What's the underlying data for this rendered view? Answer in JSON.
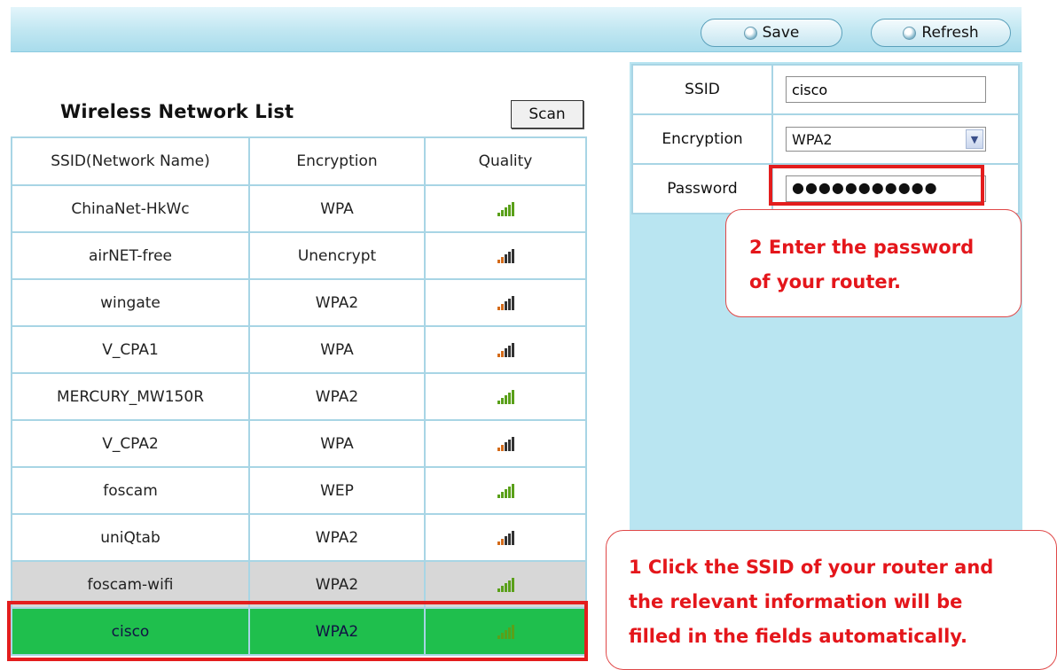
{
  "toolbar": {
    "save_label": "Save",
    "refresh_label": "Refresh"
  },
  "network_list": {
    "title": "Wireless Network List",
    "scan_label": "Scan",
    "columns": [
      "SSID(Network Name)",
      "Encryption",
      "Quality"
    ],
    "rows": [
      {
        "ssid": "ChinaNet-HkWc",
        "encryption": "WPA",
        "quality": "good"
      },
      {
        "ssid": "airNET-free",
        "encryption": "Unencrypt",
        "quality": "mid"
      },
      {
        "ssid": "wingate",
        "encryption": "WPA2",
        "quality": "mid"
      },
      {
        "ssid": "V_CPA1",
        "encryption": "WPA",
        "quality": "mid"
      },
      {
        "ssid": "MERCURY_MW150R",
        "encryption": "WPA2",
        "quality": "good"
      },
      {
        "ssid": "V_CPA2",
        "encryption": "WPA",
        "quality": "mid"
      },
      {
        "ssid": "foscam",
        "encryption": "WEP",
        "quality": "good"
      },
      {
        "ssid": "uniQtab",
        "encryption": "WPA2",
        "quality": "mid"
      },
      {
        "ssid": "foscam-wifi",
        "encryption": "WPA2",
        "quality": "good"
      },
      {
        "ssid": "cisco",
        "encryption": "WPA2",
        "quality": "good"
      }
    ]
  },
  "form": {
    "ssid_label": "SSID",
    "ssid_value": "cisco",
    "encryption_label": "Encryption",
    "encryption_value": "WPA2",
    "password_label": "Password",
    "password_value": "●●●●●●●●●●●"
  },
  "callouts": {
    "step2_line1": "2 Enter the password",
    "step2_line2": "of your router.",
    "step1_line1": "1 Click the SSID of your router and",
    "step1_line2": "the relevant information will be",
    "step1_line3": "filled in the fields automatically."
  },
  "colors": {
    "panel_blue": "#b9e5f1",
    "selected_row_green": "#1fbf4d",
    "hover_row_grey": "#d7d7d7",
    "annotation_red": "#e31d1d"
  }
}
